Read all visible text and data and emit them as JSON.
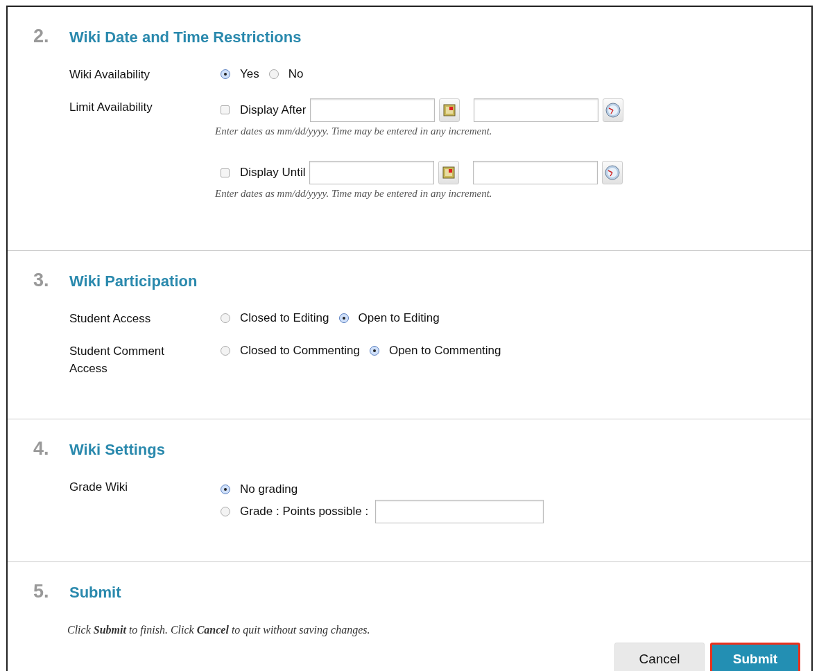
{
  "sections": [
    {
      "number": "2.",
      "title": "Wiki Date and Time Restrictions",
      "rows": [
        {
          "kind": "radio",
          "label": "Wiki Availability",
          "options": [
            {
              "label": "Yes",
              "selected": true
            },
            {
              "label": "No",
              "selected": false
            }
          ]
        },
        {
          "kind": "date_range",
          "label": "Limit Availability",
          "items": [
            {
              "label": "Display After",
              "checked": false,
              "hint": "Enter dates as mm/dd/yyyy. Time may be entered in any increment."
            },
            {
              "label": "Display Until",
              "checked": false,
              "hint": "Enter dates as mm/dd/yyyy. Time may be entered in any increment."
            }
          ]
        }
      ]
    },
    {
      "number": "3.",
      "title": "Wiki Participation",
      "rows": [
        {
          "kind": "radio",
          "label": "Student Access",
          "options": [
            {
              "label": "Closed to Editing",
              "selected": false
            },
            {
              "label": "Open to Editing",
              "selected": true
            }
          ]
        },
        {
          "kind": "radio",
          "label": "Student Comment Access",
          "options": [
            {
              "label": "Closed to Commenting",
              "selected": false
            },
            {
              "label": "Open to Commenting",
              "selected": true
            }
          ]
        }
      ]
    },
    {
      "number": "4.",
      "title": "Wiki Settings",
      "rows": [
        {
          "kind": "grade",
          "label": "Grade Wiki",
          "options": [
            {
              "label": "No grading",
              "selected": true
            },
            {
              "label": "Grade : Points possible :",
              "selected": false,
              "field": true
            }
          ]
        }
      ]
    },
    {
      "number": "5.",
      "title": "Submit",
      "instructions": "Click **Submit** to finish. Click **Cancel** to quit without saving changes.",
      "buttons": [
        {
          "label": "Cancel",
          "kind": "secondary",
          "highlighted": false
        },
        {
          "label": "Submit",
          "kind": "primary",
          "highlighted": true
        }
      ]
    }
  ]
}
